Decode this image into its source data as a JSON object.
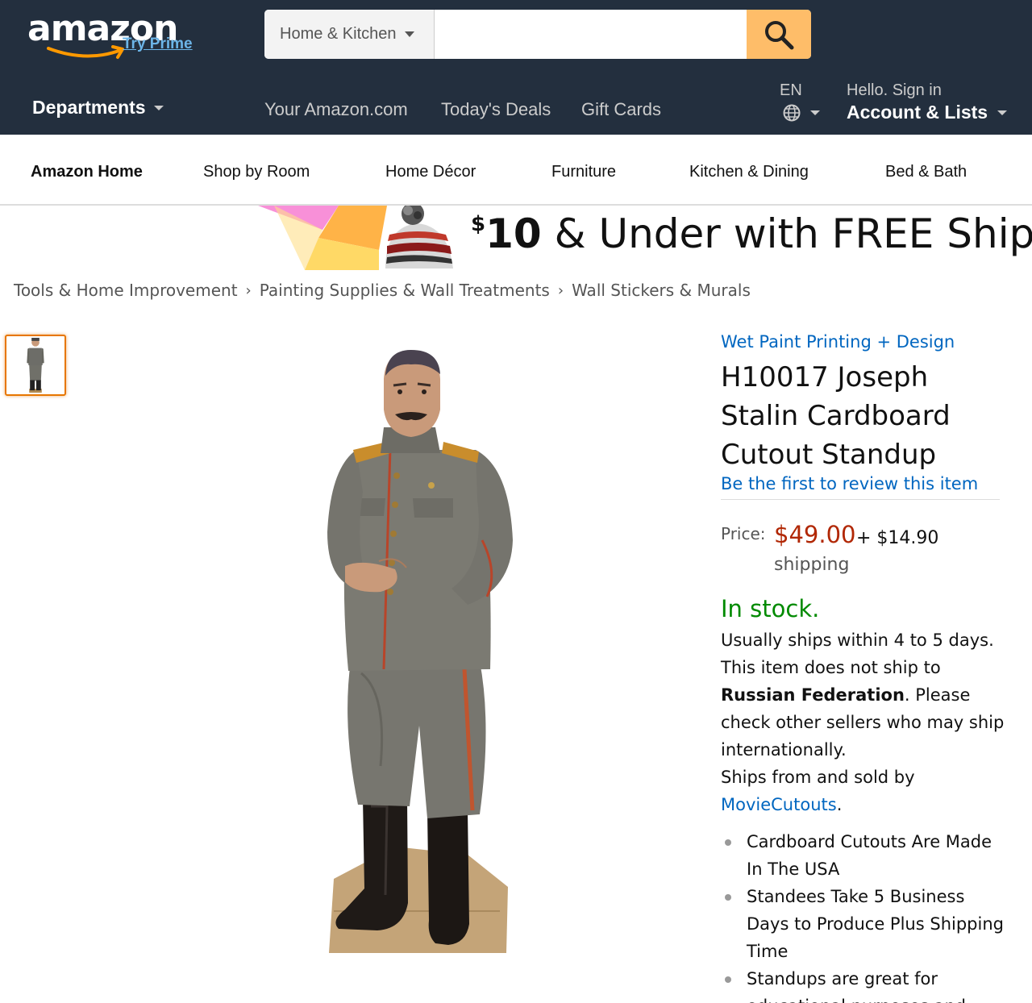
{
  "header": {
    "logo_text": "amazon",
    "try_prime": "Try Prime",
    "search": {
      "category": "Home & Kitchen",
      "value": "",
      "placeholder": ""
    },
    "departments": "Departments",
    "links": [
      "Your Amazon.com",
      "Today's Deals",
      "Gift Cards"
    ],
    "language": "EN",
    "hello": "Hello. Sign in",
    "account_lists": "Account & Lists"
  },
  "subnav": {
    "brand": "Amazon Home",
    "items": [
      "Shop by Room",
      "Home Décor",
      "Furniture",
      "Kitchen & Dining",
      "Bed & Bath"
    ]
  },
  "banner": {
    "currency": "$",
    "amount": "10",
    "text": "& Under with FREE Shipping"
  },
  "breadcrumb": [
    "Tools & Home Improvement",
    "Painting Supplies & Wall Treatments",
    "Wall Stickers & Murals"
  ],
  "product": {
    "brand": "Wet Paint Printing + Design",
    "title_lines": [
      "H10017 Joseph",
      "Stalin Cardboard",
      "Cutout Standup"
    ],
    "review_link": "Be the first to review this item",
    "price_label": "Price:",
    "price": "$49.00",
    "shipping_cost": "+ $14.90",
    "shipping_word": "shipping",
    "stock": "In stock.",
    "ship_text_1": "Usually ships within 4 to 5 days. This item does not ship to",
    "ship_country": "Russian Federation",
    "ship_text_2": ". Please check other sellers who may ship internationally.",
    "ship_text_3": "Ships from and sold by",
    "seller": "MovieCutouts",
    "period": ".",
    "bullets": [
      "Cardboard Cutouts Are Made In The USA",
      "Standees Take 5 Business Days to Produce Plus Shipping Time",
      "Standups are great for educational purposes and"
    ]
  },
  "colors": {
    "nav_bg": "#232f3e",
    "search_button": "#febd69",
    "price": "#b12704",
    "in_stock": "#008a00",
    "link": "#0066c0"
  }
}
